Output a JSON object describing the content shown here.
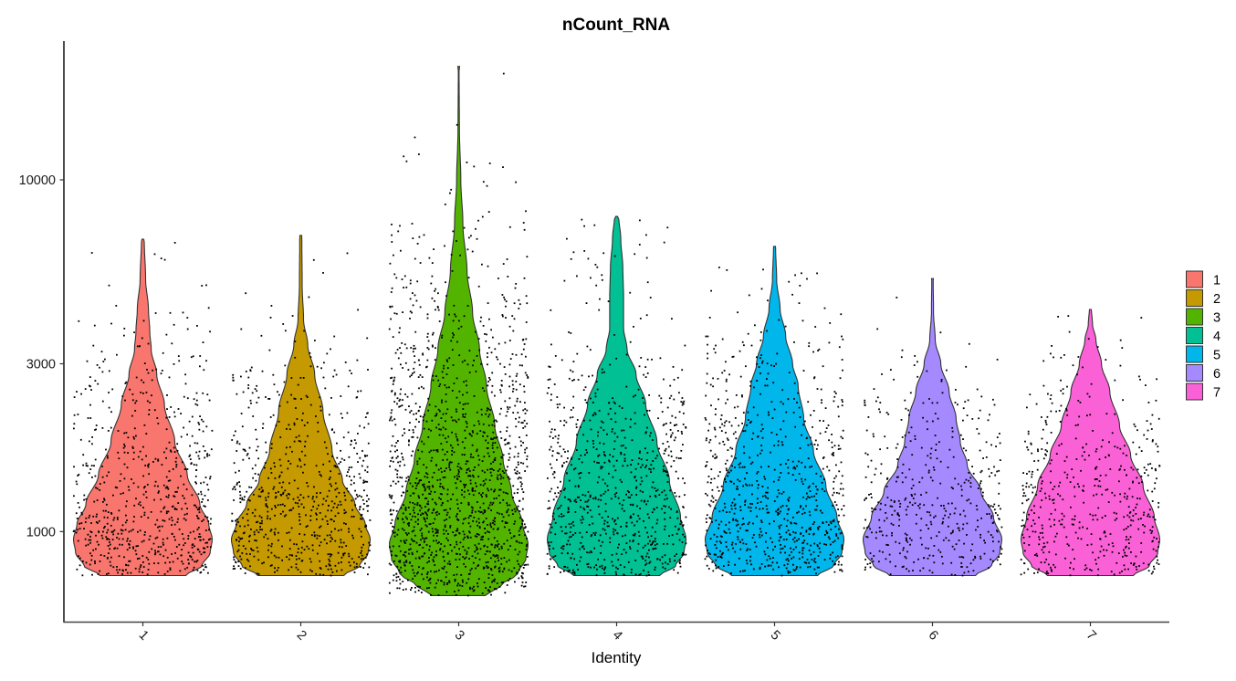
{
  "chart_data": {
    "type": "violin",
    "title": "nCount_RNA",
    "xlabel": "Identity",
    "ylabel": "",
    "y_scale": "log10",
    "ylim": [
      553,
      24800
    ],
    "yticks": [
      {
        "value": 1000,
        "label": "1000"
      },
      {
        "value": 3000,
        "label": "3000"
      },
      {
        "value": 10000,
        "label": "10000"
      }
    ],
    "categories": [
      "1",
      "2",
      "3",
      "4",
      "5",
      "6",
      "7"
    ],
    "grid": false,
    "legend": {
      "placement": "right",
      "entries": [
        {
          "label": "1",
          "color": "#F8766D"
        },
        {
          "label": "2",
          "color": "#C49A00"
        },
        {
          "label": "3",
          "color": "#53B400"
        },
        {
          "label": "4",
          "color": "#00C094"
        },
        {
          "label": "5",
          "color": "#00B6EB"
        },
        {
          "label": "6",
          "color": "#A58AFF"
        },
        {
          "label": "7",
          "color": "#FB61D7"
        }
      ]
    },
    "series": [
      {
        "name": "1",
        "color": "#F8766D",
        "min": 750,
        "max": 6780,
        "mode": 950,
        "approx_cells": 700,
        "profile": [
          [
            750,
            0.62
          ],
          [
            800,
            0.85
          ],
          [
            870,
            0.97
          ],
          [
            950,
            1.0
          ],
          [
            1050,
            0.95
          ],
          [
            1200,
            0.82
          ],
          [
            1450,
            0.64
          ],
          [
            1800,
            0.46
          ],
          [
            2300,
            0.31
          ],
          [
            2800,
            0.2
          ],
          [
            3300,
            0.12
          ],
          [
            3700,
            0.1
          ],
          [
            4300,
            0.08
          ],
          [
            5200,
            0.04
          ],
          [
            6780,
            0.02
          ]
        ]
      },
      {
        "name": "2",
        "color": "#C49A00",
        "min": 750,
        "max": 6950,
        "mode": 950,
        "approx_cells": 700,
        "profile": [
          [
            750,
            0.62
          ],
          [
            800,
            0.85
          ],
          [
            870,
            0.97
          ],
          [
            950,
            1.0
          ],
          [
            1050,
            0.93
          ],
          [
            1200,
            0.78
          ],
          [
            1400,
            0.6
          ],
          [
            1700,
            0.45
          ],
          [
            2200,
            0.32
          ],
          [
            2800,
            0.2
          ],
          [
            3400,
            0.1
          ],
          [
            4000,
            0.04
          ],
          [
            5000,
            0.02
          ],
          [
            6950,
            0.015
          ]
        ]
      },
      {
        "name": "3",
        "color": "#53B400",
        "min": 658,
        "max": 21000,
        "mode": 920,
        "approx_cells": 1500,
        "profile": [
          [
            658,
            0.38
          ],
          [
            700,
            0.6
          ],
          [
            760,
            0.85
          ],
          [
            840,
            0.97
          ],
          [
            920,
            1.0
          ],
          [
            1050,
            0.92
          ],
          [
            1300,
            0.76
          ],
          [
            1600,
            0.64
          ],
          [
            2000,
            0.52
          ],
          [
            2600,
            0.4
          ],
          [
            3300,
            0.3
          ],
          [
            4200,
            0.2
          ],
          [
            5500,
            0.12
          ],
          [
            7500,
            0.06
          ],
          [
            10000,
            0.03
          ],
          [
            14000,
            0.01
          ],
          [
            21000,
            0.005
          ]
        ]
      },
      {
        "name": "4",
        "color": "#00C094",
        "min": 750,
        "max": 7870,
        "mode": 950,
        "approx_cells": 800,
        "profile": [
          [
            750,
            0.62
          ],
          [
            800,
            0.85
          ],
          [
            870,
            0.97
          ],
          [
            950,
            1.0
          ],
          [
            1100,
            0.92
          ],
          [
            1400,
            0.76
          ],
          [
            1800,
            0.58
          ],
          [
            2300,
            0.42
          ],
          [
            2800,
            0.28
          ],
          [
            3300,
            0.15
          ],
          [
            3800,
            0.1
          ],
          [
            4600,
            0.1
          ],
          [
            5600,
            0.09
          ],
          [
            6800,
            0.06
          ],
          [
            7870,
            0.03
          ]
        ]
      },
      {
        "name": "5",
        "color": "#00B6EB",
        "min": 750,
        "max": 6470,
        "mode": 950,
        "approx_cells": 800,
        "profile": [
          [
            750,
            0.62
          ],
          [
            800,
            0.85
          ],
          [
            870,
            0.97
          ],
          [
            950,
            1.0
          ],
          [
            1100,
            0.9
          ],
          [
            1350,
            0.74
          ],
          [
            1700,
            0.56
          ],
          [
            2100,
            0.42
          ],
          [
            2600,
            0.34
          ],
          [
            3000,
            0.26
          ],
          [
            3600,
            0.16
          ],
          [
            4300,
            0.08
          ],
          [
            5200,
            0.03
          ],
          [
            6470,
            0.015
          ]
        ]
      },
      {
        "name": "6",
        "color": "#A58AFF",
        "min": 750,
        "max": 5240,
        "mode": 950,
        "approx_cells": 450,
        "profile": [
          [
            750,
            0.62
          ],
          [
            800,
            0.85
          ],
          [
            870,
            0.97
          ],
          [
            950,
            1.0
          ],
          [
            1100,
            0.88
          ],
          [
            1300,
            0.7
          ],
          [
            1550,
            0.5
          ],
          [
            1800,
            0.4
          ],
          [
            2100,
            0.34
          ],
          [
            2500,
            0.24
          ],
          [
            3000,
            0.12
          ],
          [
            3500,
            0.04
          ],
          [
            4200,
            0.015
          ],
          [
            5240,
            0.01
          ]
        ]
      },
      {
        "name": "7",
        "color": "#FB61D7",
        "min": 750,
        "max": 4280,
        "mode": 950,
        "approx_cells": 500,
        "profile": [
          [
            750,
            0.62
          ],
          [
            800,
            0.85
          ],
          [
            870,
            0.97
          ],
          [
            950,
            1.0
          ],
          [
            1100,
            0.92
          ],
          [
            1350,
            0.76
          ],
          [
            1650,
            0.58
          ],
          [
            2000,
            0.42
          ],
          [
            2500,
            0.28
          ],
          [
            3000,
            0.16
          ],
          [
            3500,
            0.08
          ],
          [
            3900,
            0.03
          ],
          [
            4280,
            0.015
          ]
        ]
      }
    ]
  }
}
